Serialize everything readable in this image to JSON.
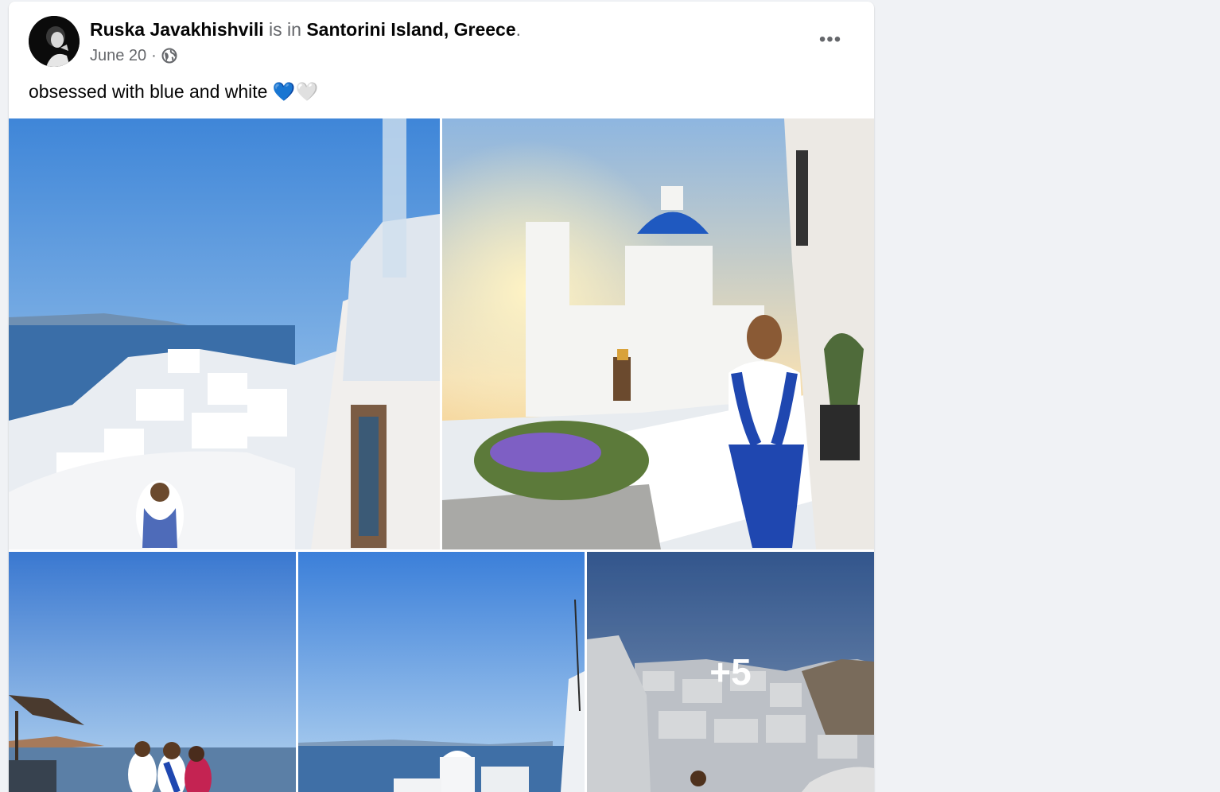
{
  "post": {
    "author_name": "Ruska Javakhishvili",
    "connector": " is in ",
    "location": "Santorini Island, Greece",
    "period": ".",
    "date": "June 20",
    "separator": "·",
    "audience_icon": "globe-icon",
    "more_icon": "ellipsis-icon",
    "more_label": "•••",
    "text": "obsessed with blue and white 💙🤍"
  },
  "photos": {
    "overflow_count": "+5"
  },
  "colors": {
    "sky_top": "#3f86d8",
    "sky_bottom": "#a7cdee",
    "sea": "#3a6ea8",
    "dome_blue": "#1f59c0",
    "white_buildings": "#f2f3f5",
    "sunset": "#ffd27a"
  }
}
